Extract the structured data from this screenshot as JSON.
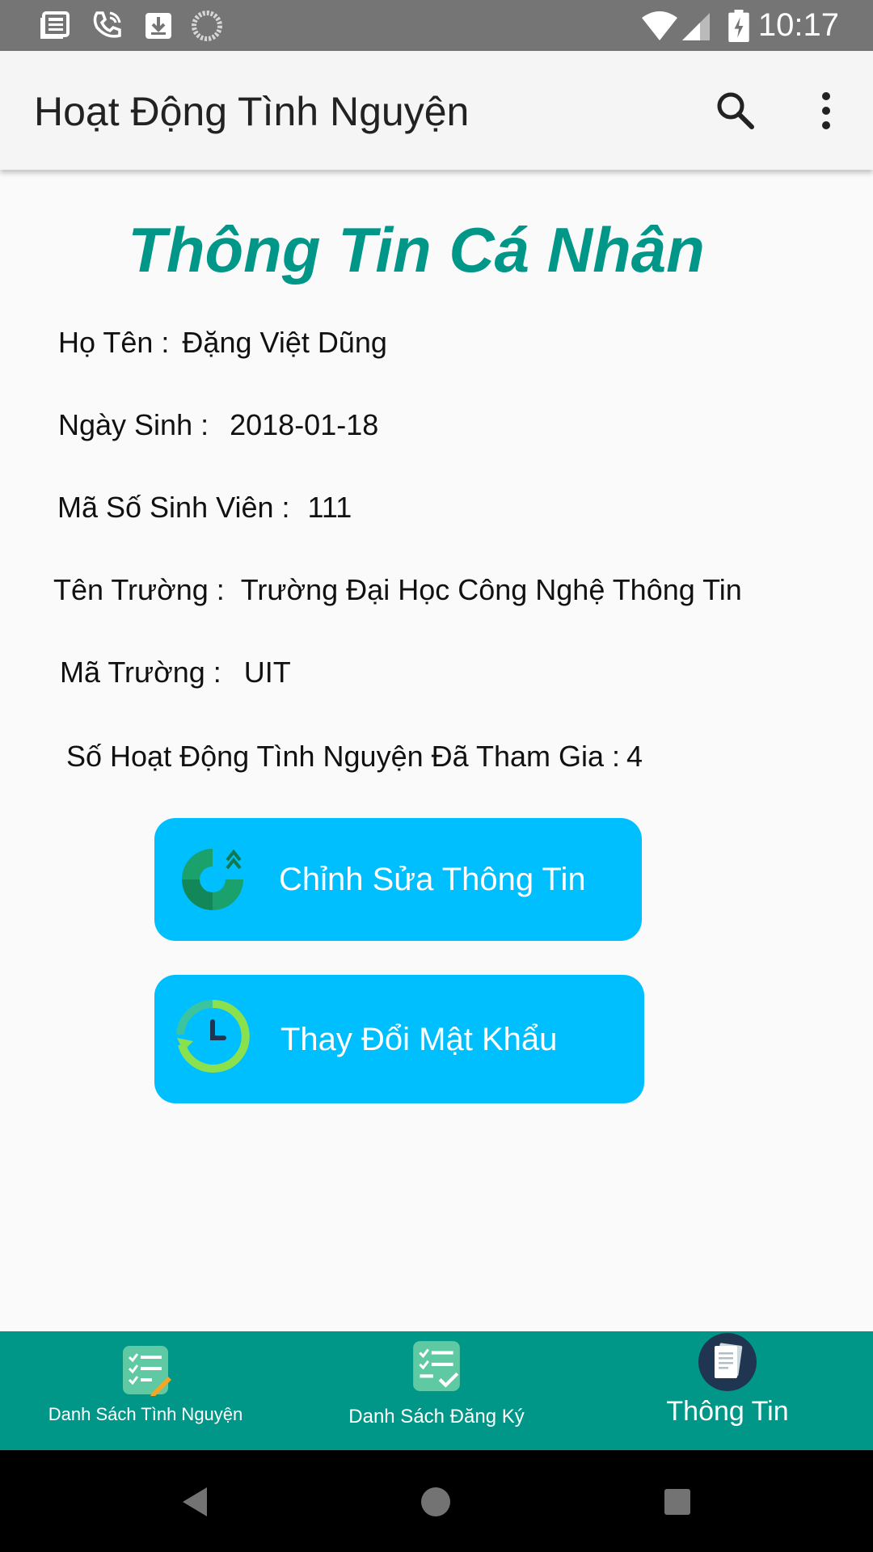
{
  "status_bar": {
    "time": "10:17",
    "icons": [
      "news-icon",
      "phone-wifi-icon",
      "download-icon",
      "sync-icon",
      "wifi-icon",
      "signal-icon",
      "battery-charging-icon"
    ]
  },
  "app_bar": {
    "title": "Hoạt Động Tình Nguyện",
    "actions": [
      "search-icon",
      "more-vert-icon"
    ]
  },
  "profile": {
    "heading": "Thông Tin Cá Nhân",
    "fields": [
      {
        "label": "Họ Tên :",
        "value": "Đặng Việt Dũng"
      },
      {
        "label": "Ngày Sinh :",
        "value": "2018-01-18"
      },
      {
        "label": "Mã Số Sinh Viên :",
        "value": "111"
      },
      {
        "label": "Tên Trường :",
        "value": "Trường Đại Học Công Nghệ Thông Tin"
      },
      {
        "label": "Mã Trường :",
        "value": "UIT"
      },
      {
        "label": "Số Hoạt Động Tình Nguyện Đã Tham Gia :",
        "value": "4"
      }
    ]
  },
  "buttons": {
    "edit_info": {
      "label": "Chỉnh Sửa Thông Tin",
      "icon": "refresh-arrow-icon"
    },
    "change_password": {
      "label": "Thay Đổi Mật Khẩu",
      "icon": "clock-refresh-icon"
    }
  },
  "bottom_nav": {
    "items": [
      {
        "label": "Danh Sách Tình Nguyện",
        "icon": "checklist-pencil-icon"
      },
      {
        "label": "Danh Sách Đăng Ký",
        "icon": "checklist-check-icon"
      },
      {
        "label": "Thông Tin",
        "icon": "document-icon",
        "selected": true
      }
    ]
  },
  "colors": {
    "accent": "#009688",
    "button": "#00bfff",
    "status_bar": "#757575",
    "app_bar": "#f5f5f5"
  }
}
